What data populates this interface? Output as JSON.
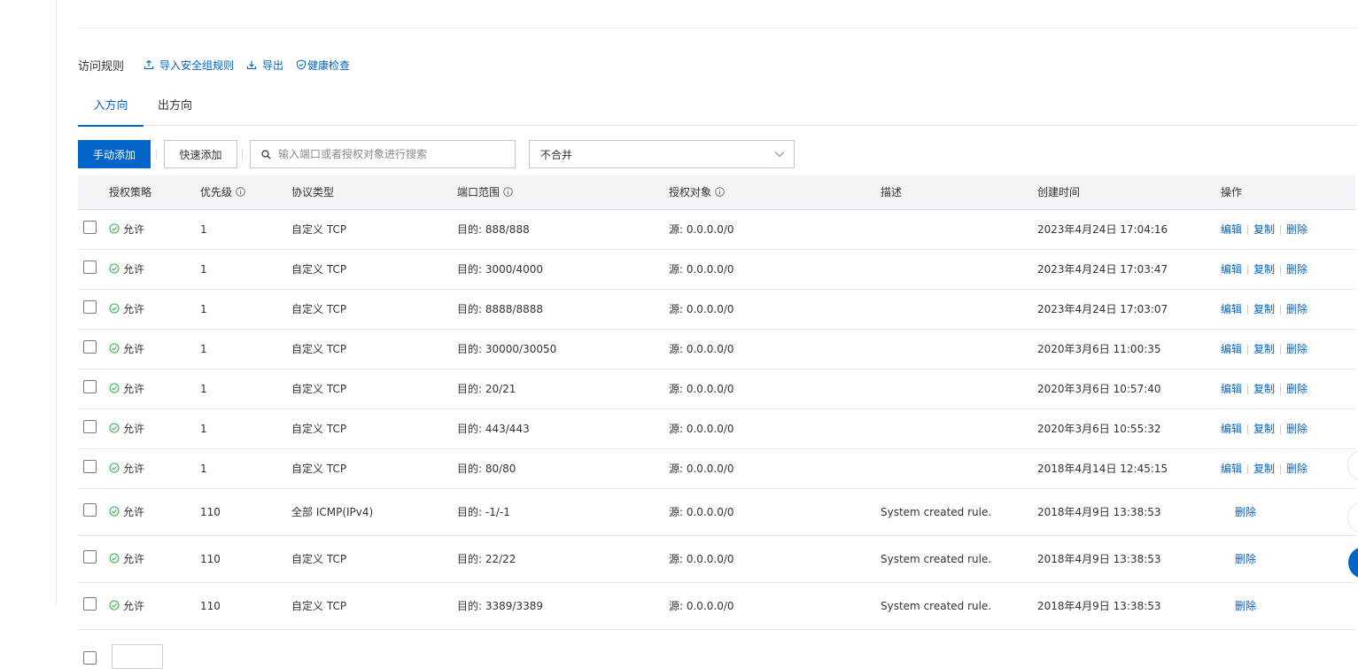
{
  "section": {
    "title": "访问规则",
    "links": [
      {
        "label": "导入安全组规则",
        "icon": "upload-icon"
      },
      {
        "label": "导出",
        "icon": "download-icon"
      },
      {
        "label": "健康检查",
        "icon": "shield-check-icon"
      }
    ]
  },
  "tabs": [
    {
      "label": "入方向",
      "active": true
    },
    {
      "label": "出方向",
      "active": false
    }
  ],
  "toolbar": {
    "add_manual_label": "手动添加",
    "add_quick_label": "快速添加",
    "search_placeholder": "输入端口或者授权对象进行搜索",
    "merge_select_value": "不合并"
  },
  "colors": {
    "primary": "#0064c8",
    "allow": "#35b34a"
  },
  "table": {
    "headers": {
      "policy": "授权策略",
      "priority": "优先级",
      "protocol": "协议类型",
      "port_range": "端口范围",
      "auth_object": "授权对象",
      "description": "描述",
      "created": "创建时间",
      "actions": "操作"
    },
    "actions": {
      "edit": "编辑",
      "copy": "复制",
      "delete": "删除"
    },
    "rows": [
      {
        "policy": "允许",
        "priority": "1",
        "protocol": "自定义 TCP",
        "port": "目的: 888/888",
        "source": "源: 0.0.0.0/0",
        "description": "",
        "created": "2023年4月24日 17:04:16"
      },
      {
        "policy": "允许",
        "priority": "1",
        "protocol": "自定义 TCP",
        "port": "目的: 3000/4000",
        "source": "源: 0.0.0.0/0",
        "description": "",
        "created": "2023年4月24日 17:03:47"
      },
      {
        "policy": "允许",
        "priority": "1",
        "protocol": "自定义 TCP",
        "port": "目的: 8888/8888",
        "source": "源: 0.0.0.0/0",
        "description": "",
        "created": "2023年4月24日 17:03:07"
      },
      {
        "policy": "允许",
        "priority": "1",
        "protocol": "自定义 TCP",
        "port": "目的: 30000/30050",
        "source": "源: 0.0.0.0/0",
        "description": "",
        "created": "2020年3月6日 11:00:35"
      },
      {
        "policy": "允许",
        "priority": "1",
        "protocol": "自定义 TCP",
        "port": "目的: 20/21",
        "source": "源: 0.0.0.0/0",
        "description": "",
        "created": "2020年3月6日 10:57:40"
      },
      {
        "policy": "允许",
        "priority": "1",
        "protocol": "自定义 TCP",
        "port": "目的: 443/443",
        "source": "源: 0.0.0.0/0",
        "description": "",
        "created": "2020年3月6日 10:55:32"
      },
      {
        "policy": "允许",
        "priority": "1",
        "protocol": "自定义 TCP",
        "port": "目的: 80/80",
        "source": "源: 0.0.0.0/0",
        "description": "",
        "created": "2018年4月14日 12:45:15"
      },
      {
        "policy": "允许",
        "priority": "110",
        "protocol": "全部 ICMP(IPv4)",
        "port": "目的: -1/-1",
        "source": "源: 0.0.0.0/0",
        "description": "System created rule.",
        "created": "2018年4月9日 13:38:53"
      },
      {
        "policy": "允许",
        "priority": "110",
        "protocol": "自定义 TCP",
        "port": "目的: 22/22",
        "source": "源: 0.0.0.0/0",
        "description": "System created rule.",
        "created": "2018年4月9日 13:38:53"
      },
      {
        "policy": "允许",
        "priority": "110",
        "protocol": "自定义 TCP",
        "port": "目的: 3389/3389",
        "source": "源: 0.0.0.0/0",
        "description": "System created rule.",
        "created": "2018年4月9日 13:38:53"
      }
    ]
  }
}
